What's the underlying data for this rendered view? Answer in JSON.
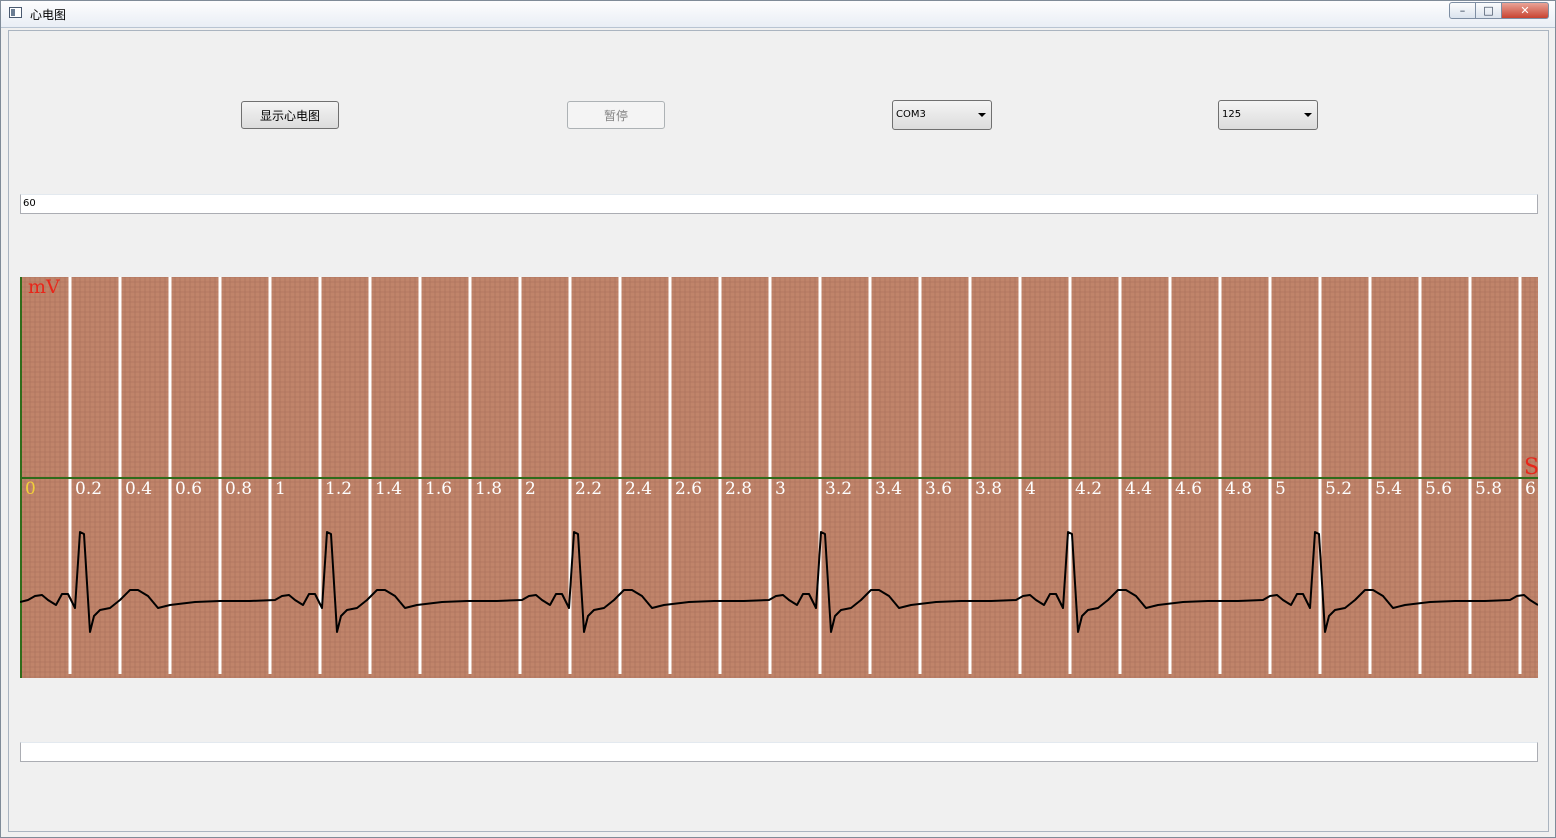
{
  "window": {
    "title": "心电图",
    "controls": {
      "minimize": "–",
      "maximize": "□",
      "close": "✕"
    }
  },
  "toolbar": {
    "show_ecg_label": "显示心电图",
    "pause_label": "暂停",
    "port_value": "COM3",
    "rate_value": "125"
  },
  "heart_rate_field": {
    "value": "60"
  },
  "bottom_field": {
    "value": ""
  },
  "ecg": {
    "y_unit_label": "mV",
    "x_unit_label": "S",
    "x_tick_labels": [
      "0",
      "0.2",
      "0.4",
      "0.6",
      "0.8",
      "1",
      "1.2",
      "1.4",
      "1.6",
      "1.8",
      "2",
      "2.2",
      "2.4",
      "2.6",
      "2.8",
      "3",
      "3.2",
      "3.4",
      "3.6",
      "3.8",
      "4",
      "4.2",
      "4.4",
      "4.6",
      "4.8",
      "5",
      "5.2",
      "5.4",
      "5.6",
      "5.8",
      "6"
    ],
    "colors": {
      "grid_background": "#c0846a",
      "minor_grid": "#a36e5a",
      "major_divider": "#ffffff",
      "baseline": "#2f6b1a",
      "unit_label": "#e8261a",
      "origin_label": "#f2d13a",
      "trace": "#000000"
    }
  }
}
